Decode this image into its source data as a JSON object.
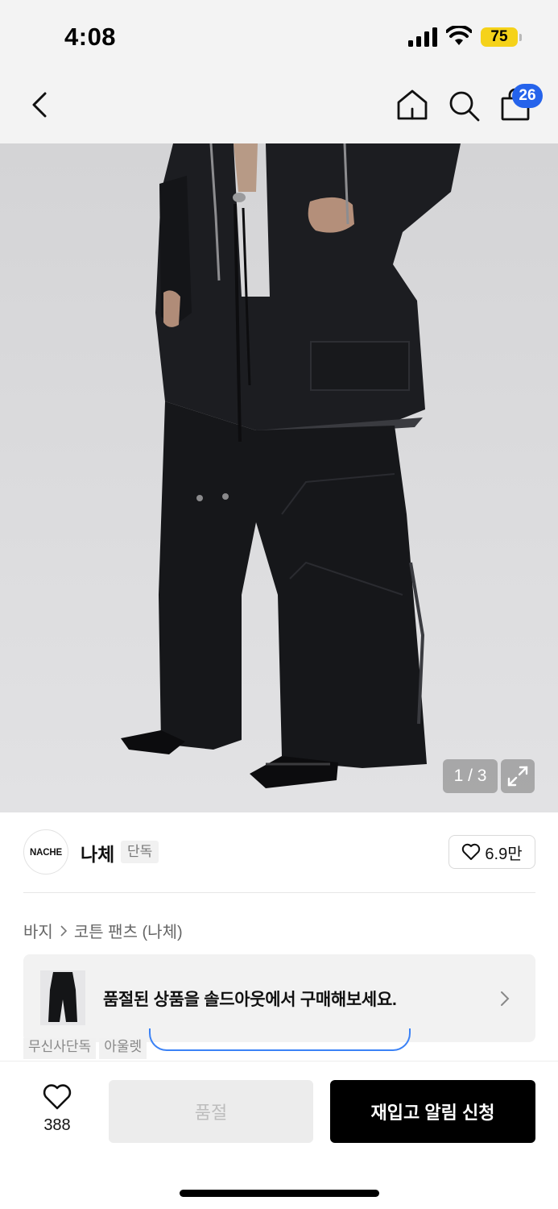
{
  "status_bar": {
    "time": "4:08",
    "battery": "75"
  },
  "nav": {
    "cart_count": "26"
  },
  "gallery": {
    "counter": "1 / 3"
  },
  "brand": {
    "logo_text": "NACHE",
    "name": "나체",
    "tag": "단독",
    "likes": "6.9만"
  },
  "breadcrumb": {
    "category": "바지",
    "current": "코튼 팬츠 (나체)"
  },
  "banner": {
    "text": "품절된 상품을 솔드아웃에서 구매해보세요."
  },
  "peek_tags": [
    "무신사단독",
    "아울렛"
  ],
  "bottom_bar": {
    "favorite_count": "388",
    "soldout_label": "품절",
    "restock_label": "재입고 알림 신청"
  },
  "icons": [
    "back-icon",
    "home-icon",
    "search-icon",
    "cart-icon",
    "expand-icon",
    "heart-icon",
    "chevron-right-icon"
  ],
  "colors": {
    "accent_blue": "#2563eb",
    "battery_yellow": "#f5d21a",
    "primary_button": "#000000",
    "disabled_button": "#ececec"
  }
}
